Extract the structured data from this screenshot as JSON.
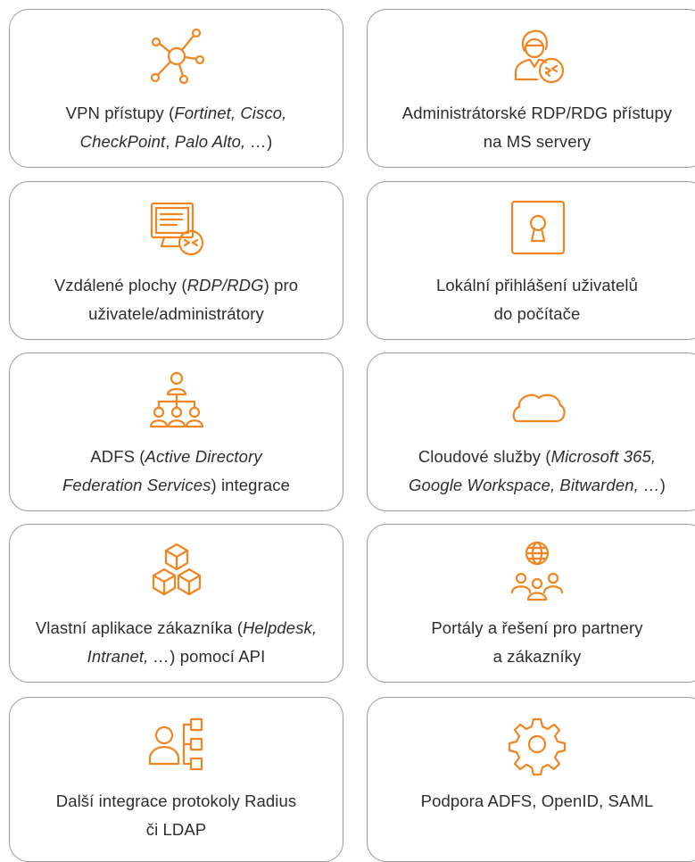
{
  "accent_color": "#f08522",
  "border_color": "#9a9a9a",
  "cards": [
    {
      "icon": "network-hub-icon",
      "line1": {
        "a": "VPN přístupy (",
        "i": "Fortinet, Cisco,",
        "b": ""
      },
      "line2": {
        "a": "",
        "i": "CheckPoint",
        "b": ", ",
        "i2": "Palo Alto, …",
        "c": ")"
      }
    },
    {
      "icon": "admin-remote-icon",
      "line1": "Administrátorské RDP/RDG přístupy",
      "line2": "na MS servery"
    },
    {
      "icon": "remote-desktop-icon",
      "line1": {
        "a": "Vzdálené plochy (",
        "i": "RDP/RDG",
        "b": ") pro"
      },
      "line2": "uživatele/administrátory"
    },
    {
      "icon": "keyhole-lock-icon",
      "line1": "Lokální přihlášení uživatelů",
      "line2": "do počítače"
    },
    {
      "icon": "org-hierarchy-icon",
      "line1": {
        "a": "ADFS (",
        "i": "Active Directory",
        "b": ""
      },
      "line2": {
        "a": "",
        "i": "Federation Services",
        "b": ") integrace"
      }
    },
    {
      "icon": "cloud-icon",
      "line1": {
        "a": "Cloudové služby (",
        "i": "Microsoft 365,",
        "b": ""
      },
      "line2": {
        "a": "",
        "i": "Google Workspace, Bitwarden, …",
        "b": ")"
      }
    },
    {
      "icon": "cubes-icon",
      "line1": {
        "a": "Vlastní aplikace zákazníka (",
        "i": "Helpdesk,",
        "b": ""
      },
      "line2": {
        "a": "",
        "i": "Intranet, …",
        "b": ") pomocí API"
      }
    },
    {
      "icon": "globe-people-icon",
      "line1": "Portály a řešení pro partnery",
      "line2": "a zákazníky"
    },
    {
      "icon": "user-tree-icon",
      "line1": "Další integrace protokoly Radius",
      "line2": "či LDAP"
    },
    {
      "icon": "gear-icon",
      "line1": "Podpora ADFS, OpenID, SAML",
      "line2": ""
    }
  ]
}
